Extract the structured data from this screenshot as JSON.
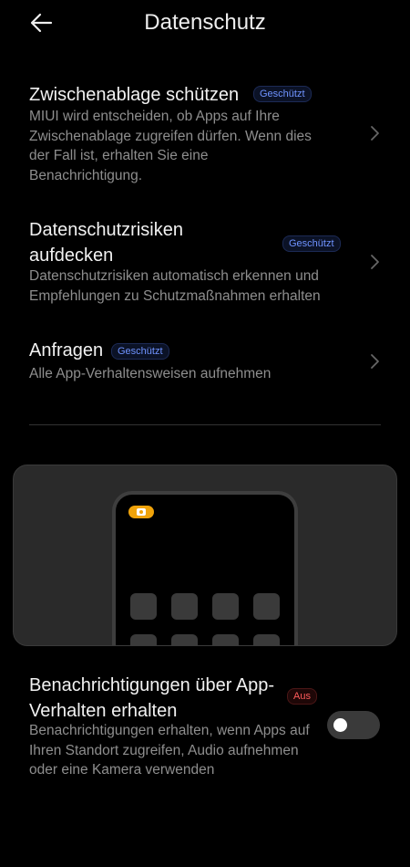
{
  "header": {
    "title": "Datenschutz"
  },
  "items": [
    {
      "title": "Zwischenablage schützen",
      "badge": "Geschützt",
      "description": "MIUI wird entscheiden, ob Apps auf Ihre Zwischenablage zugreifen dürfen. Wenn dies der Fall ist, erhalten Sie eine Benachrichtigung."
    },
    {
      "title": "Datenschutzrisiken aufdecken",
      "badge": "Geschützt",
      "description": "Datenschutzrisiken automatisch erkennen und Empfehlungen zu Schutzmaßnahmen erhalten"
    },
    {
      "title": "Anfragen",
      "badge": "Geschützt",
      "description": "Alle App-Verhaltensweisen aufnehmen"
    }
  ],
  "notification": {
    "title": "Benachrichtigungen über App-Verhalten erhalten",
    "badge": "Aus",
    "description": "Benachrichtigungen erhalten, wenn Apps auf Ihren Standort zugreifen, Audio aufnehmen oder eine Kamera verwenden",
    "enabled": false
  },
  "colors": {
    "background": "#000000",
    "accent_badge": "#6f93ff",
    "off_badge": "#ff5b5b",
    "camera_indicator": "#f0a30a"
  },
  "icons": {
    "back": "back-arrow-icon",
    "chevron": "chevron-right-icon",
    "camera": "camera-icon"
  }
}
